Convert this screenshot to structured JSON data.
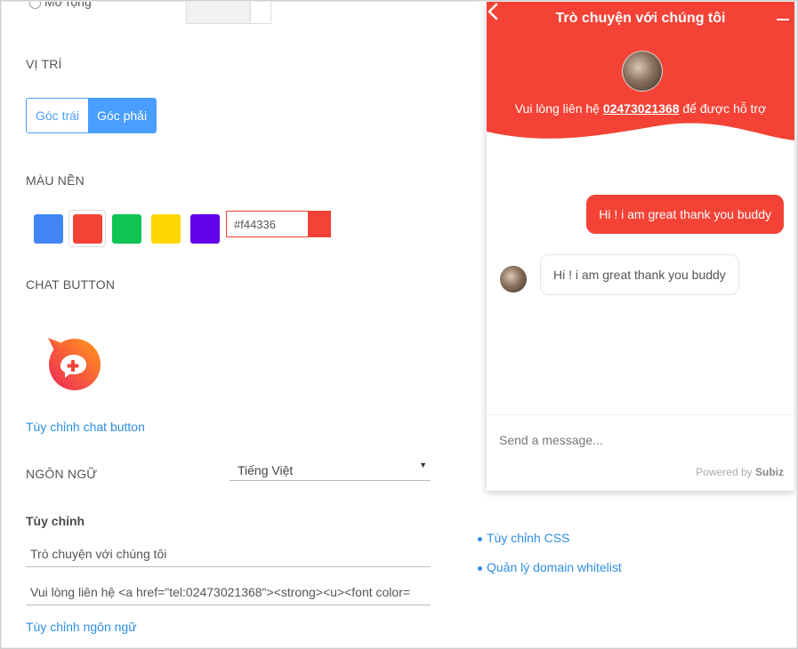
{
  "settings": {
    "top_radio_label": "Mở rộng",
    "position": {
      "label": "VỊ TRÍ",
      "left": "Góc trái",
      "right": "Góc phải",
      "selected": "Góc phải"
    },
    "background_color": {
      "label": "MÀU NỀN",
      "swatches": [
        "#4285f4",
        "#f44336",
        "#0fc553",
        "#ffd600",
        "#6200ea"
      ],
      "selected": "#f44336",
      "hex_value": "#f44336"
    },
    "chat_button": {
      "label": "CHAT BUTTON",
      "customize_link": "Tùy chỉnh chat button"
    },
    "language": {
      "label": "NGÔN NGỮ",
      "selected": "Tiếng Việt"
    },
    "customize": {
      "label": "Tùy chỉnh",
      "title_value": "Trò chuyện với chúng tôi",
      "subtitle_value": "Vui lòng liên hệ <a href=\"tel:02473021368\"><strong><u><font color=",
      "language_link": "Tùy chỉnh ngôn ngữ"
    },
    "links": {
      "css": "Tùy chỉnh CSS",
      "whitelist": "Quản lý domain whitelist"
    }
  },
  "widget": {
    "accent": "#f44336",
    "title": "Trò chuyện với chúng tôi",
    "subtitle_before": "Vui lòng liên hệ ",
    "phone": "02473021368",
    "subtitle_after": " để được hỗ trợ",
    "messages": [
      {
        "from": "visitor",
        "text": "Hi ! i am great thank you buddy"
      },
      {
        "from": "agent",
        "text": "Hi ! i am great thank you buddy"
      }
    ],
    "composer_placeholder": "Send a message...",
    "powered_by": "Powered by",
    "powered_brand": "Subiz"
  }
}
